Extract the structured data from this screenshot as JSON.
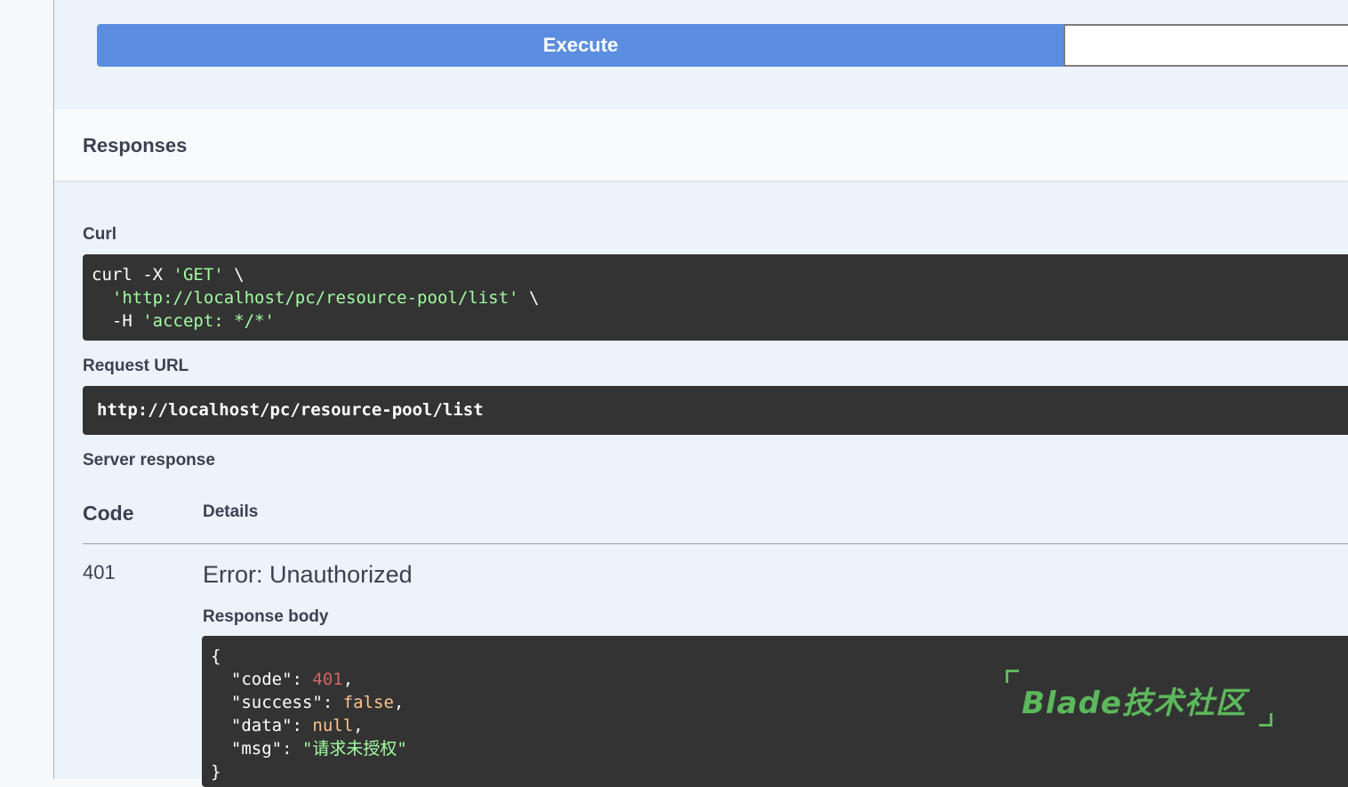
{
  "execute": {
    "label": "Execute"
  },
  "responses": {
    "title": "Responses"
  },
  "curl": {
    "label": "Curl",
    "line1_cmd": "curl -X ",
    "line1_method": "'GET'",
    "line1_tail": " \\",
    "line2_indent": "  ",
    "line2_url": "'http://localhost/pc/resource-pool/list'",
    "line2_tail": " \\",
    "line3_cmd": "  -H ",
    "line3_header": "'accept: */*'"
  },
  "request_url": {
    "label": "Request URL",
    "value": "http://localhost/pc/resource-pool/list"
  },
  "server_response": {
    "label": "Server response",
    "col_code": "Code",
    "col_details": "Details",
    "code": "401",
    "title": "Error: Unauthorized",
    "body_label": "Response body",
    "body": {
      "open": "{",
      "k_code": "  \"code\": ",
      "v_code": "401",
      "k_success": "  \"success\": ",
      "v_success": "false",
      "k_data": "  \"data\": ",
      "v_data": "null",
      "k_msg": "  \"msg\": ",
      "v_msg": "\"请求未授权\"",
      "close": "}"
    }
  },
  "watermark": {
    "text": "Blade技术社区"
  },
  "colors": {
    "execute_bg": "#5b8ee0",
    "code_bg": "#333333",
    "string": "#a2fca2",
    "number": "#d36363",
    "keyword": "#fcc28c",
    "watermark": "#5cb85c"
  }
}
